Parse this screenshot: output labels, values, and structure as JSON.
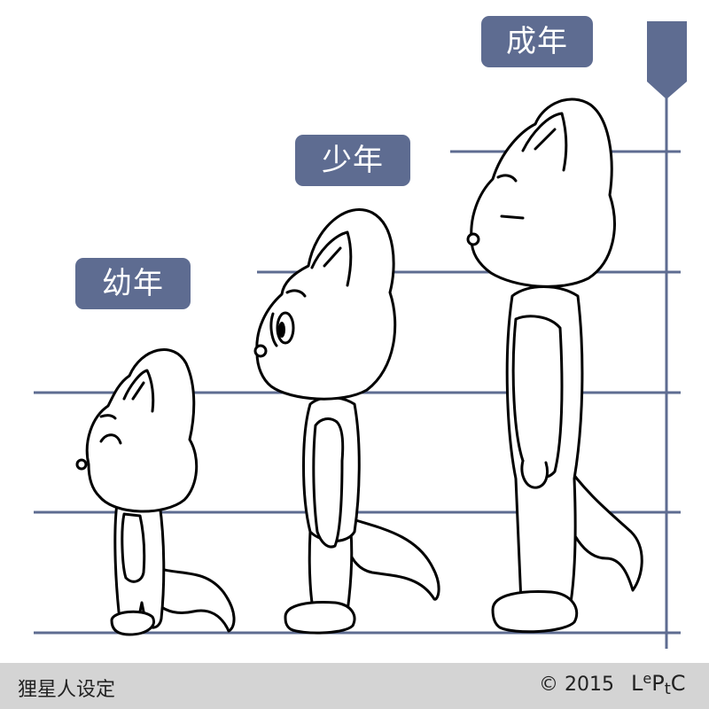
{
  "labels": {
    "adult": "成年",
    "teen": "少年",
    "child": "幼年"
  },
  "footer": {
    "title": "狸星人设定",
    "copyright": "© 2015",
    "logo_parts": [
      "L",
      "e",
      "P",
      "t",
      "C"
    ]
  },
  "colors": {
    "badge": "#5e6c91",
    "lines": "#5e6c91",
    "footer_bg": "#d4d4d4"
  },
  "icons": {
    "marker": "bookmark-marker-icon"
  }
}
